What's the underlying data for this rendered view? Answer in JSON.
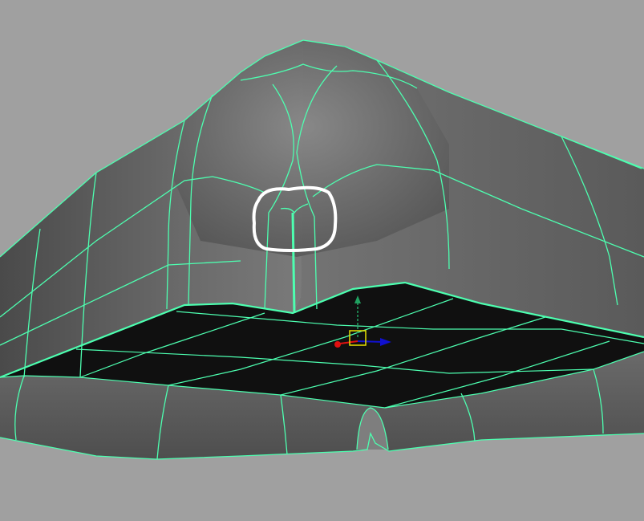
{
  "viewport": {
    "background_color": "#a0a0a0",
    "wireframe_color": "#4dffb0",
    "annotation_color": "#ffffff",
    "shaded_surface_color": "#707070",
    "selected_face_color": "#101010"
  },
  "manipulator": {
    "x_axis_color": "#e01010",
    "y_axis_color": "#20a060",
    "z_axis_color": "#1010d0",
    "center_color": "#e8e000"
  },
  "icons": {
    "annotation": "circle-highlight-icon",
    "gizmo": "move-manipulator-icon"
  }
}
